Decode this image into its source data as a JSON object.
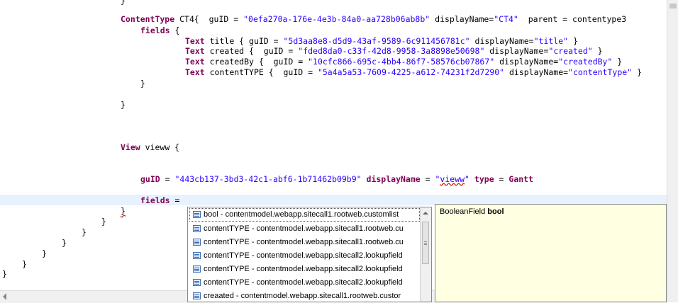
{
  "editor": {
    "code": {
      "l1": "}",
      "l2_kw": "ContentType",
      "l2_a": " CT4{  guID = ",
      "l2_guid": "\"0efa270a-176e-4e3b-84a0-aa728b06ab8b\"",
      "l2_b": " displayName=",
      "l2_name": "\"CT4\"",
      "l2_c": "  parent = contentype3",
      "l3_kw": "fields",
      "l3_a": " {",
      "f1_kw": "Text",
      "f1_a": " title { guID = ",
      "f1_guid": "\"5d3aa8e8-d5d9-43af-9589-6c911456781c\"",
      "f1_b": " displayName=",
      "f1_name": "\"title\"",
      "f1_c": " }",
      "f2_kw": "Text",
      "f2_a": " created {  guID = ",
      "f2_guid": "\"fded8da0-c33f-42d8-9958-3a8898e50698\"",
      "f2_b": " displayName=",
      "f2_name": "\"created\"",
      "f2_c": " }",
      "f3_kw": "Text",
      "f3_a": " createdBy {  guID = ",
      "f3_guid": "\"10cfc866-695c-4bb4-86f7-58576cb07867\"",
      "f3_b": " displayName=",
      "f3_name": "\"createdBy\"",
      "f3_c": " }",
      "f4_kw": "Text",
      "f4_a": " contentTYPE {  guID = ",
      "f4_guid": "\"5a4a5a53-7609-4225-a612-74231f2d7290\"",
      "f4_b": " displayName=",
      "f4_name": "\"contentType\"",
      "f4_c": " }",
      "close_fields": "}",
      "close_ct": "}",
      "view_kw": "View",
      "view_a": " vieww {",
      "g_kw": "guID",
      "g_a": " = ",
      "g_guid": "\"443cb137-3bd3-42c1-abf6-1b71462b09b9\"",
      "g_b": " ",
      "g_kw2": "displayName",
      "g_c": " = ",
      "g_name_q1": "\"",
      "g_name": "vieww",
      "g_name_q2": "\"",
      "g_d": " ",
      "g_kw3": "type",
      "g_e": " = ",
      "g_kw4": "Gantt",
      "fi_kw": "fields",
      "fi_a": " =",
      "b1": "}",
      "b2": "}",
      "b3": "}",
      "b4": "}",
      "b5": "}",
      "b6": "}",
      "b7": "}"
    }
  },
  "autocomplete": {
    "items": [
      "bool - contentmodel.webapp.sitecall1.rootweb.customlist",
      "contentTYPE - contentmodel.webapp.sitecall1.rootweb.cu",
      "contentTYPE - contentmodel.webapp.sitecall1.rootweb.cu",
      "contentTYPE - contentmodel.webapp.sitecall2.lookupfield",
      "contentTYPE - contentmodel.webapp.sitecall2.lookupfield",
      "contentTYPE - contentmodel.webapp.sitecall2.lookupfield",
      "creaated - contentmodel.webapp.sitecall1.rootweb.custor"
    ],
    "icon": "field-list-icon"
  },
  "info": {
    "type": "BooleanField",
    "name": "bool"
  }
}
